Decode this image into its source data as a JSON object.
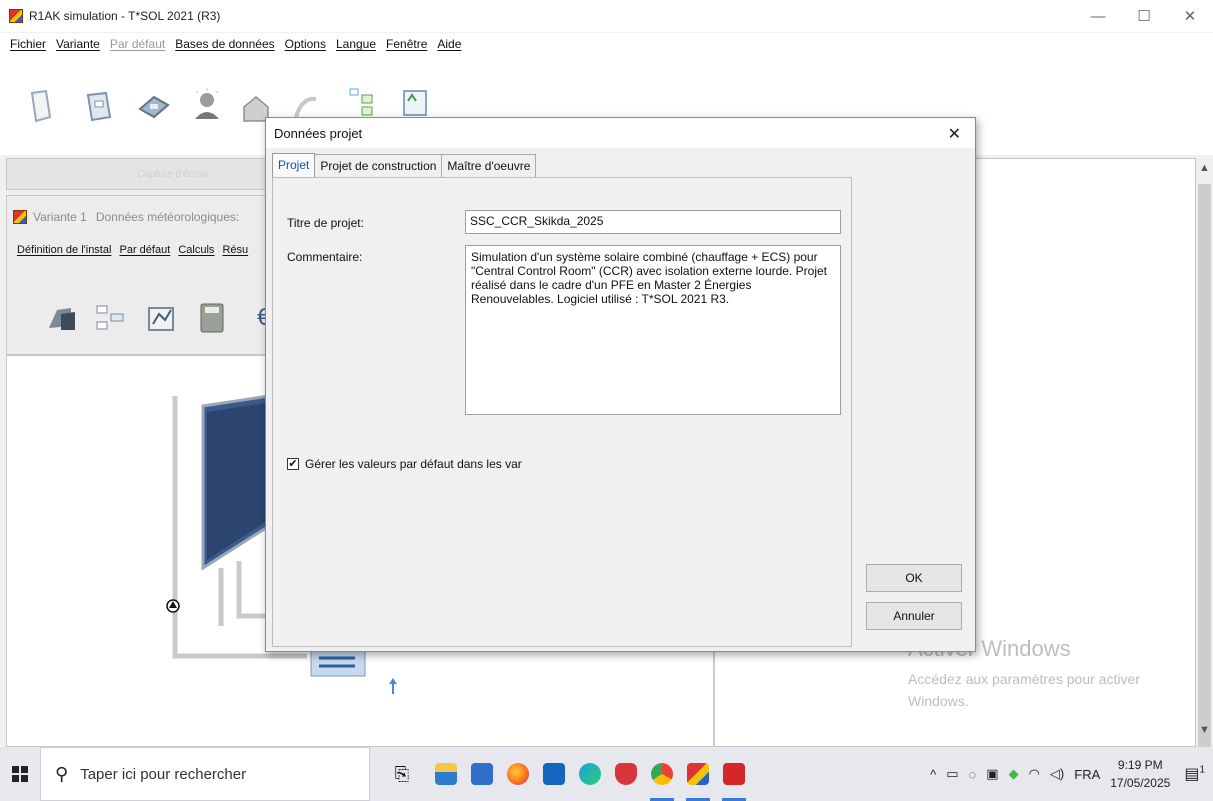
{
  "window": {
    "title": "R1AK simulation - T*SOL 2021 (R3)",
    "controls": [
      "—",
      "☐",
      "✕"
    ]
  },
  "menubar": [
    {
      "label": "Fichier",
      "enabled": true
    },
    {
      "label": "Variante",
      "enabled": true
    },
    {
      "label": "Par défaut",
      "enabled": false
    },
    {
      "label": "Bases de données",
      "enabled": true
    },
    {
      "label": "Options",
      "enabled": true
    },
    {
      "label": "Langue",
      "enabled": true
    },
    {
      "label": "Fenêtre",
      "enabled": true
    },
    {
      "label": "Aide",
      "enabled": true
    }
  ],
  "toolbar_icons": [
    "new-project-icon",
    "open-folder-icon",
    "save-disk-icon",
    "user-icon",
    "building-icon",
    "climate-icon",
    "system-icon",
    "report-icon"
  ],
  "variant": {
    "title_part1": "Variante 1",
    "title_part2": "Données météorologiques:",
    "menu": [
      "Définition de l'instal",
      "Par défaut",
      "Calculs",
      "Résu"
    ]
  },
  "dialog": {
    "title": "Données projet",
    "close": "✕",
    "tabs": [
      "Projet",
      "Projet de construction",
      "Maître d'oeuvre"
    ],
    "active_tab": 0,
    "fields": {
      "title_label": "Titre de projet:",
      "title_value": "SSC_CCR_Skikda_2025",
      "comment_label": "Commentaire:",
      "comment_value": "Simulation d'un système solaire combiné (chauffage + ECS) pour \"Central Control Room\" (CCR) avec isolation externe lourde. Projet réalisé dans le cadre d'un PFE en Master 2 Énergies Renouvelables. Logiciel utilisé : T*SOL 2021 R3."
    },
    "checkbox": {
      "label": "Gérer les valeurs par défaut dans les var",
      "checked": true,
      "mark": "✔"
    },
    "buttons": {
      "ok": "OK",
      "cancel": "Annuler"
    }
  },
  "watermark": {
    "title": "Activer Windows",
    "subtitle": "Accédez aux paramètres pour activer Windows."
  },
  "taskbar": {
    "search_placeholder": "Taper ici pour rechercher",
    "language": "FRA",
    "time": "9:19 PM",
    "date": "17/05/2025",
    "notification_count": "1"
  },
  "colors": {
    "dialog_bg": "#f0f0f0",
    "active_tab_text": "#1a4fb5",
    "taskbar_bg": "#e7e7ee"
  }
}
